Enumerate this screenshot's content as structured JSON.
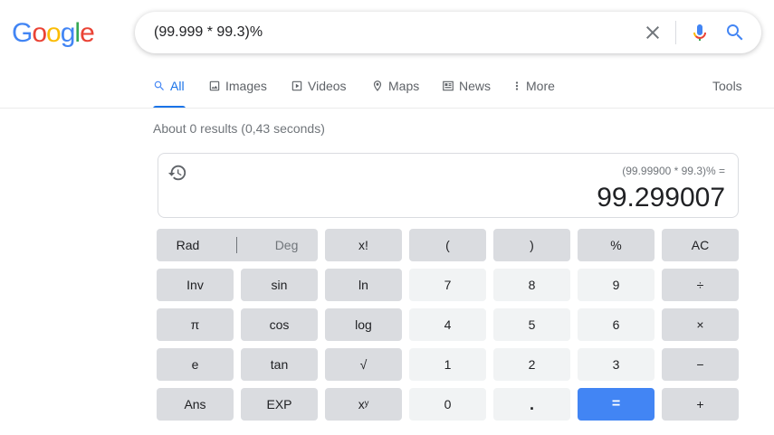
{
  "logo": {
    "letters": [
      {
        "ch": "G",
        "color": "#4285f4"
      },
      {
        "ch": "o",
        "color": "#ea4335"
      },
      {
        "ch": "o",
        "color": "#fbbc05"
      },
      {
        "ch": "g",
        "color": "#4285f4"
      },
      {
        "ch": "l",
        "color": "#34a853"
      },
      {
        "ch": "e",
        "color": "#ea4335"
      }
    ]
  },
  "search": {
    "query": "(99.999 * 99.3)%",
    "clear_icon": "close-icon",
    "mic_icon": "mic-icon",
    "search_icon": "search-icon"
  },
  "tabs": [
    {
      "label": "All",
      "icon": "search-icon",
      "active": true
    },
    {
      "label": "Images",
      "icon": "image-icon"
    },
    {
      "label": "Videos",
      "icon": "video-icon"
    },
    {
      "label": "Maps",
      "icon": "map-pin-icon"
    },
    {
      "label": "News",
      "icon": "news-icon"
    },
    {
      "label": "More",
      "icon": "more-vert-icon"
    }
  ],
  "tools_label": "Tools",
  "result_stats": "About 0 results (0,43 seconds)",
  "calculator": {
    "expression": "(99.99900 * 99.3)% =",
    "result": "99.299007",
    "history_icon": "history-icon",
    "mode": {
      "rad": "Rad",
      "deg": "Deg"
    },
    "keys": [
      [
        "x!",
        "(",
        ")",
        "%",
        "AC"
      ],
      [
        "Inv",
        "sin",
        "ln",
        "7",
        "8",
        "9",
        "÷"
      ],
      [
        "π",
        "cos",
        "log",
        "4",
        "5",
        "6",
        "×"
      ],
      [
        "e",
        "tan",
        "√",
        "1",
        "2",
        "3",
        "−"
      ],
      [
        "Ans",
        "EXP",
        "xʸ",
        "0",
        ".",
        "=",
        "+"
      ]
    ],
    "colors": {
      "function_key": "#dadce0",
      "number_key": "#f1f3f4",
      "equals_key": "#4285f4"
    }
  }
}
